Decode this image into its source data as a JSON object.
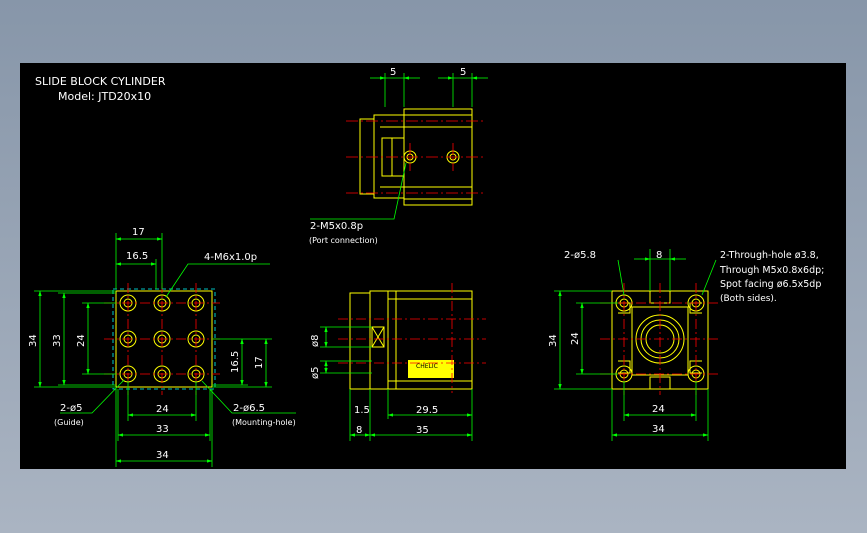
{
  "title": {
    "line1": "SLIDE BLOCK CYLINDER",
    "line2": "Model:  JTD20x10"
  },
  "top_view": {
    "dim_left": "5",
    "dim_right": "5",
    "port_label": "2-M5x0.8p",
    "port_note": "(Port connection)"
  },
  "left_view": {
    "dim_17_top": "17",
    "dim_16_5_top": "16.5",
    "thread": "4-M6x1.0p",
    "dim_34_left": "34",
    "dim_33_left": "33",
    "dim_24_left": "24",
    "dim_16_5_right": "16.5",
    "dim_17_right": "17",
    "guide_label": "2-ø5",
    "guide_note": "(Guide)",
    "mount_label": "2-ø6.5",
    "mount_note": "(Mounting-hole)",
    "dim_24_bottom": "24",
    "dim_33_bottom": "33",
    "dim_34_bottom": "34"
  },
  "middle_view": {
    "dim_phi8": "ø8",
    "dim_phi5": "ø5",
    "dim_1_5": "1.5",
    "dim_29_5": "29.5",
    "dim_8": "8",
    "dim_35": "35",
    "nameplate": "CHELIC"
  },
  "right_view": {
    "hole_label": "2-ø5.8",
    "dim_8_top": "8",
    "through_line1": "2-Through-hole ø3.8,",
    "through_line2": "Through M5x0.8x6dp;",
    "through_line3": "Spot facing ø6.5x5dp",
    "through_line4": "(Both sides).",
    "dim_34_left": "34",
    "dim_24_left": "24",
    "dim_24_bottom": "24",
    "dim_34_bottom": "34"
  },
  "colors": {
    "background": "#000000",
    "outline": "#ffff00",
    "dimension": "#00ff00",
    "centerline": "#ff0000",
    "text": "#ffffff",
    "hidden": "#00ffff"
  }
}
